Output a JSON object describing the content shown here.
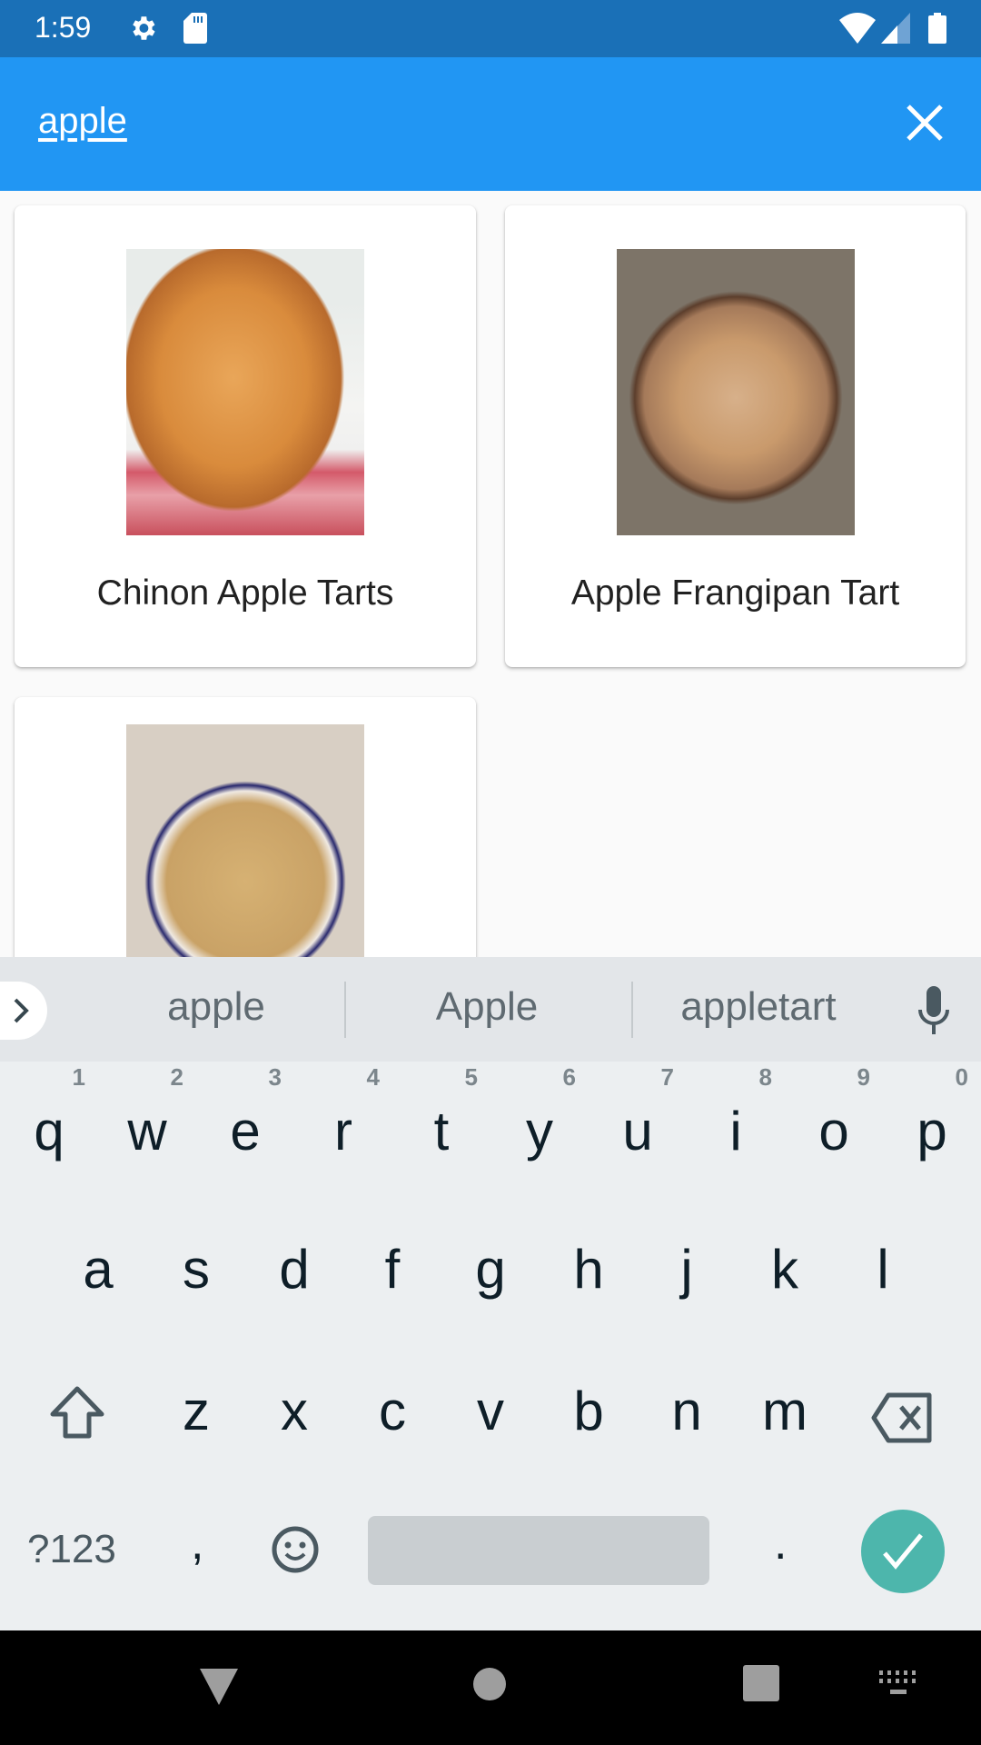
{
  "status_bar": {
    "time": "1:59",
    "icons": [
      "settings-icon",
      "sd-card-icon",
      "wifi-icon",
      "signal-icon",
      "battery-icon"
    ]
  },
  "app_bar": {
    "search_value": "apple",
    "close_icon": "close-icon"
  },
  "recipes": [
    {
      "title": "Chinon Apple Tarts"
    },
    {
      "title": "Apple Frangipan Tart"
    },
    {
      "title": ""
    }
  ],
  "keyboard": {
    "suggestions": [
      "apple",
      "Apple",
      "appletart"
    ],
    "row1": [
      {
        "k": "q",
        "h": "1"
      },
      {
        "k": "w",
        "h": "2"
      },
      {
        "k": "e",
        "h": "3"
      },
      {
        "k": "r",
        "h": "4"
      },
      {
        "k": "t",
        "h": "5"
      },
      {
        "k": "y",
        "h": "6"
      },
      {
        "k": "u",
        "h": "7"
      },
      {
        "k": "i",
        "h": "8"
      },
      {
        "k": "o",
        "h": "9"
      },
      {
        "k": "p",
        "h": "0"
      }
    ],
    "row2": [
      "a",
      "s",
      "d",
      "f",
      "g",
      "h",
      "j",
      "k",
      "l"
    ],
    "row3": [
      "z",
      "x",
      "c",
      "v",
      "b",
      "n",
      "m"
    ],
    "symbols_label": "?123",
    "comma": ",",
    "period": ".",
    "enter_color": "#4db6ac"
  },
  "colors": {
    "status": "#1a70b7",
    "appbar": "#2196f3"
  }
}
